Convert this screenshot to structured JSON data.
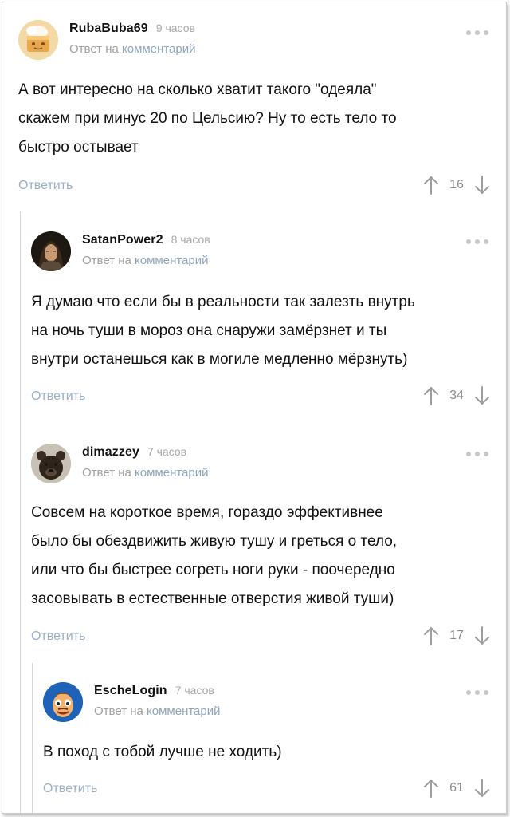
{
  "comments": [
    {
      "username": "RubaBuba69",
      "time": "9 часов",
      "reply_prefix": "Ответ на",
      "reply_link": "комментарий",
      "text": "А вот интересно на сколько хватит такого \"одеяла\"\nскажем при минус 20 по Цельсию? Ну то есть тело то\nбыстро остывает",
      "reply_label": "Ответить",
      "votes": "16"
    },
    {
      "username": "SatanPower2",
      "time": "8 часов",
      "reply_prefix": "Ответ на",
      "reply_link": "комментарий",
      "text": "Я думаю что если бы в реальности так залезть внутрь\nна ночь туши в мороз она снаружи замёрзнет и ты\nвнутри останешься как в могиле медленно мёрзнуть)",
      "reply_label": "Ответить",
      "votes": "34"
    },
    {
      "username": "dimazzey",
      "time": "7 часов",
      "reply_prefix": "Ответ на",
      "reply_link": "комментарий",
      "text": "Совсем на короткое время, гораздо эффективнее\nбыло бы обездвижить живую тушу и греться о тело,\nили что бы быстрее согреть ноги руки - поочередно\nзасовывать в естественные отверстия живой туши)",
      "reply_label": "Ответить",
      "votes": "17"
    },
    {
      "username": "EscheLogin",
      "time": "7 часов",
      "reply_prefix": "Ответ на",
      "reply_link": "комментарий",
      "text": "В поход с тобой лучше не ходить)",
      "reply_label": "Ответить",
      "votes": "61"
    }
  ],
  "colors": {
    "link": "#8fa5bd",
    "muted": "#a0a0a0",
    "thread_line": "#d6d6d6"
  },
  "icons": {
    "upvote": "arrow-up-icon",
    "downvote": "arrow-down-icon",
    "more": "more-dots-icon"
  }
}
